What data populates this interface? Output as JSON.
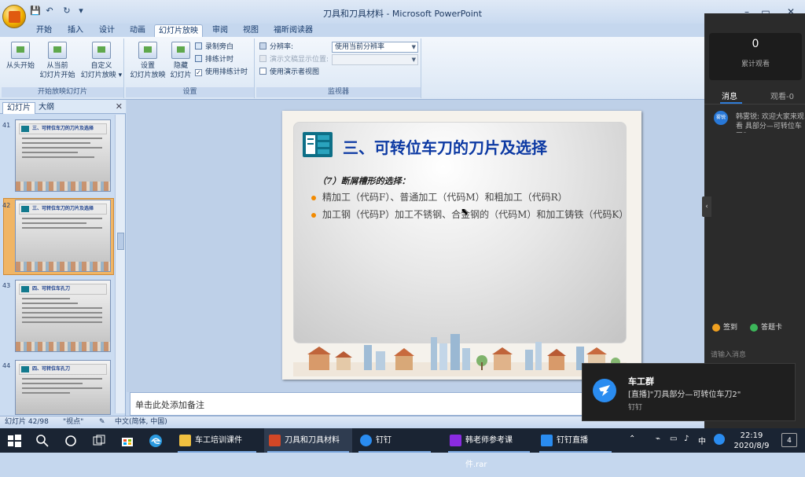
{
  "window": {
    "title": "刀具和刀具材料 - Microsoft PowerPoint",
    "min": "–",
    "max": "▭",
    "close": "✕"
  },
  "quick_access": {
    "save": "💾",
    "undo": "↶",
    "redo": "↻",
    "more": "▾"
  },
  "ribbon_tabs": [
    "开始",
    "插入",
    "设计",
    "动画",
    "幻灯片放映",
    "审阅",
    "视图",
    "福昕阅读器"
  ],
  "ribbon_active_tab": "幻灯片放映",
  "ribbon": {
    "group_start": {
      "label": "开始放映幻灯片",
      "btn_from_start": "从头开始",
      "btn_from_current_1": "从当前",
      "btn_from_current_2": "幻灯片开始",
      "btn_custom_1": "自定义",
      "btn_custom_2": "幻灯片放映 ▾"
    },
    "group_setup": {
      "label": "设置",
      "btn_setup_1": "设置",
      "btn_setup_2": "幻灯片放映",
      "btn_hide_1": "隐藏",
      "btn_hide_2": "幻灯片",
      "record_narration": "录制旁白",
      "rehearse_timings": "排练计时",
      "use_timings": "使用排练计时",
      "use_timings_checked": "✓"
    },
    "group_monitors": {
      "label": "监视器",
      "resolution_label": "分辨率:",
      "resolution_value": "使用当前分辨率",
      "show_on_label": "演示文稿显示位置:",
      "show_on_value": "",
      "presenter_view": "使用演示者视图"
    }
  },
  "slide_panel": {
    "tab_slides": "幻灯片",
    "tab_outline": "大纲",
    "close": "✕",
    "thumbnails": [
      {
        "num": "41",
        "title": "三、可转位车刀的刀片及选择"
      },
      {
        "num": "42",
        "title": "三、可转位车刀的刀片及选择"
      },
      {
        "num": "43",
        "title": "四、可转位车孔刀"
      },
      {
        "num": "44",
        "title": "四、可转位车孔刀"
      }
    ]
  },
  "slide": {
    "title": "三、可转位车刀的刀片及选择",
    "subtitle": "（7）断屑槽形的选择：",
    "bullets": [
      "精加工（代码F）、普通加工（代码M）和粗加工（代码R）",
      "加工钢（代码P）加工不锈钢、合金钢的（代码M）和加工铸铁（代码K）"
    ]
  },
  "notes_placeholder": "单击此处添加备注",
  "status_bar": {
    "slide_info": "幻灯片 42/98",
    "theme": "\"视点\"",
    "language": "中文(简体, 中国)"
  },
  "chat": {
    "count": "0",
    "count_label": "累计观看",
    "tab_messages": "消息",
    "tab_viewers": "观看-0",
    "msg_avatar": "雾锐",
    "msg_text": "韩雾锐: 欢迎大家来观看 具部分—可转位车刀2",
    "btn_sign": "签到",
    "btn_answer": "答题卡",
    "input_placeholder": "请输入消息",
    "collapse": "‹"
  },
  "toast": {
    "title": "车工群",
    "body": "[直播]\"刀具部分—可转位车刀2\"",
    "app": "钉钉"
  },
  "taskbar": {
    "apps": [
      {
        "label": "车工培训课件",
        "color": "#f0c040"
      },
      {
        "label": "刀具和刀具材料",
        "color": "#d24726"
      },
      {
        "label": "钉钉",
        "color": "#2a8cf0"
      },
      {
        "label": "韩老师参考课件.rar",
        "color": "#8a2be2"
      },
      {
        "label": "钉钉直播",
        "color": "#2a8cf0"
      }
    ],
    "tray": {
      "ime": "中",
      "time": "22:19",
      "date": "2020/8/9",
      "notif": "4"
    }
  },
  "colors": {
    "slide_title": "#0c39a3",
    "bullet_dot": "#f28a00",
    "accent": "#2a8cf0"
  }
}
